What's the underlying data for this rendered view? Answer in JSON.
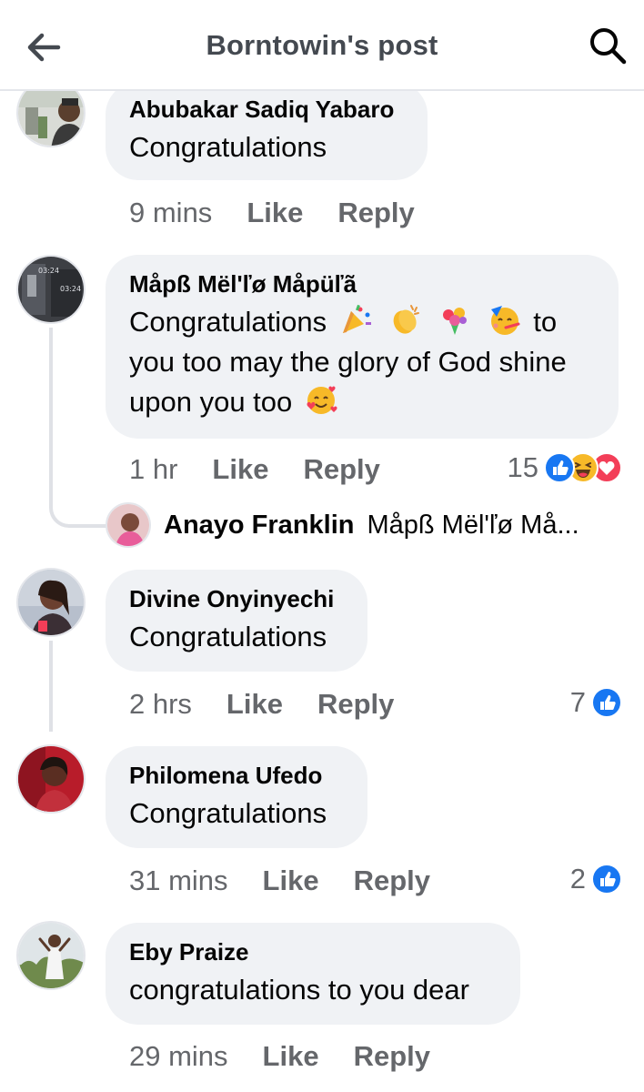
{
  "header": {
    "title": "Borntowin's post"
  },
  "comments": [
    {
      "author": "Abubakar Sadiq Yabaro",
      "text": "Congratulations",
      "time": "9 mins",
      "like": "Like",
      "reply": "Reply"
    },
    {
      "author": "Måpß Mël'ľø Måpüľã",
      "text_a": "Congratulations",
      "text_b": "to",
      "text_c": "you too may the glory of God shine",
      "text_d": "upon you too",
      "time": "1 hr",
      "like": "Like",
      "reply": "Reply",
      "reactions": "15"
    },
    {
      "author": "Divine Onyinyechi",
      "text": "Congratulations",
      "time": "2 hrs",
      "like": "Like",
      "reply": "Reply",
      "reactions": "7"
    },
    {
      "author": "Philomena Ufedo",
      "text": "Congratulations",
      "time": "31 mins",
      "like": "Like",
      "reply": "Reply",
      "reactions": "2"
    },
    {
      "author": "Eby Praize",
      "text": "congratulations to you dear",
      "time": "29 mins",
      "like": "Like",
      "reply": "Reply"
    }
  ],
  "reply_preview": {
    "author": "Anayo Franklin",
    "snippet": "Måpß Mël'ľø Må..."
  },
  "colors": {
    "like_blue": "#1877f2",
    "love_red": "#f33e58",
    "haha_yellow": "#f7b928",
    "meta_gray": "#65676b"
  }
}
